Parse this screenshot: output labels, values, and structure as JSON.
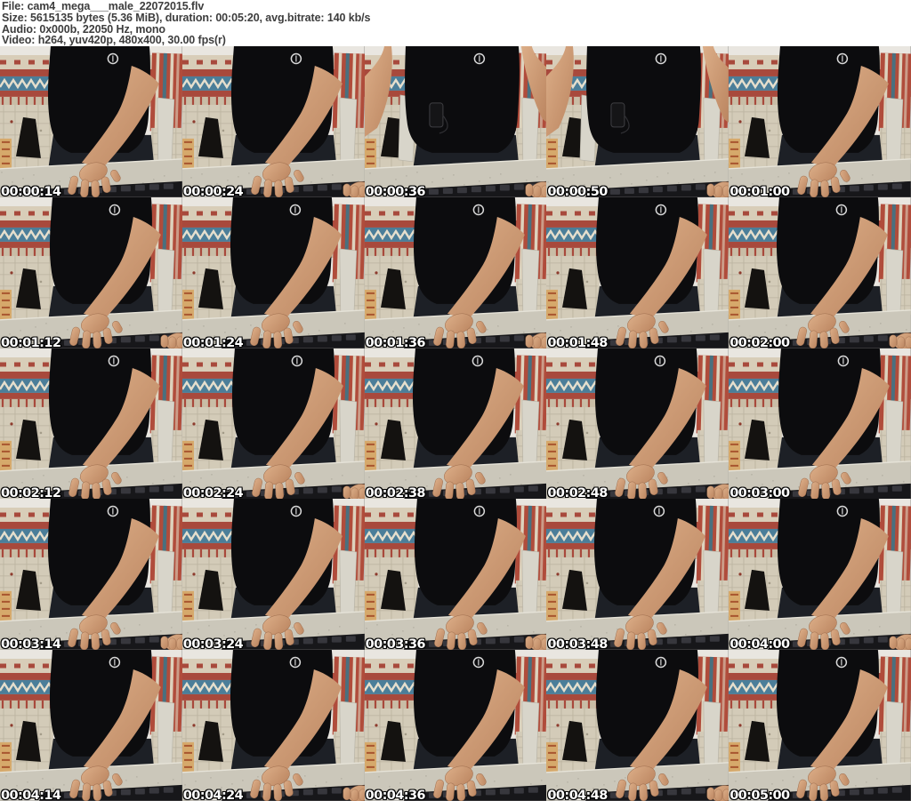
{
  "header": {
    "file": "File: cam4_mega___male_22072015.flv",
    "size": "Size: 5615135 bytes (5.36 MiB), duration: 00:05:20, avg.bitrate: 140 kb/s",
    "audio": "Audio: 0x000b, 22050 Hz, mono",
    "video": "Video: h264, yuv420p, 480x400, 30.00 fps(r)"
  },
  "grid": {
    "columns": 5,
    "rows": 5,
    "thumbnails": [
      {
        "timestamp": "00:00:14",
        "pose": "reach"
      },
      {
        "timestamp": "00:00:24",
        "pose": "reach"
      },
      {
        "timestamp": "00:00:36",
        "pose": "sit"
      },
      {
        "timestamp": "00:00:50",
        "pose": "sit"
      },
      {
        "timestamp": "00:01:00",
        "pose": "reach"
      },
      {
        "timestamp": "00:01:12",
        "pose": "reach"
      },
      {
        "timestamp": "00:01:24",
        "pose": "reach"
      },
      {
        "timestamp": "00:01:36",
        "pose": "reach"
      },
      {
        "timestamp": "00:01:48",
        "pose": "reach"
      },
      {
        "timestamp": "00:02:00",
        "pose": "reach"
      },
      {
        "timestamp": "00:02:12",
        "pose": "reach"
      },
      {
        "timestamp": "00:02:24",
        "pose": "reach"
      },
      {
        "timestamp": "00:02:38",
        "pose": "reach"
      },
      {
        "timestamp": "00:02:48",
        "pose": "reach"
      },
      {
        "timestamp": "00:03:00",
        "pose": "reach"
      },
      {
        "timestamp": "00:03:14",
        "pose": "reach"
      },
      {
        "timestamp": "00:03:24",
        "pose": "reach"
      },
      {
        "timestamp": "00:03:36",
        "pose": "reach"
      },
      {
        "timestamp": "00:03:48",
        "pose": "reach"
      },
      {
        "timestamp": "00:04:00",
        "pose": "reach"
      },
      {
        "timestamp": "00:04:14",
        "pose": "reach"
      },
      {
        "timestamp": "00:04:24",
        "pose": "reach"
      },
      {
        "timestamp": "00:04:36",
        "pose": "reach"
      },
      {
        "timestamp": "00:04:48",
        "pose": "reach"
      },
      {
        "timestamp": "00:05:00",
        "pose": "reach"
      }
    ]
  },
  "colors": {
    "header_text": "#3d3d3d",
    "page_background": "#ffffff",
    "timestamp_text": "#ffffff",
    "timestamp_outline": "#000000",
    "scene": {
      "wall": "#e9e6e0",
      "kilim_red": "#a8493c",
      "kilim_blue": "#4b7e99",
      "kilim_cream": "#d8cdb8",
      "kilim_stripe_cream": "#ddd2bd",
      "kilim_stripe_blue": "#49707f",
      "kilim_right_red": "#b04c3b",
      "floor": "#d3cbb8",
      "floor_grout": "#b7af9b",
      "floor_object": "#d6a96b",
      "chair": "#dcd9d0",
      "chair_edge": "#b9b5a8",
      "shirt": "#0c0c0e",
      "jeans": "#1d2026",
      "skin_light": "#dcae88",
      "skin_dark": "#bb8560",
      "desk": "#cbc7ba",
      "desk_highlight": "#e6e3d8",
      "keyboard": "#17171a",
      "keycap": "#37373d",
      "logo": "#d9d9d9"
    }
  }
}
